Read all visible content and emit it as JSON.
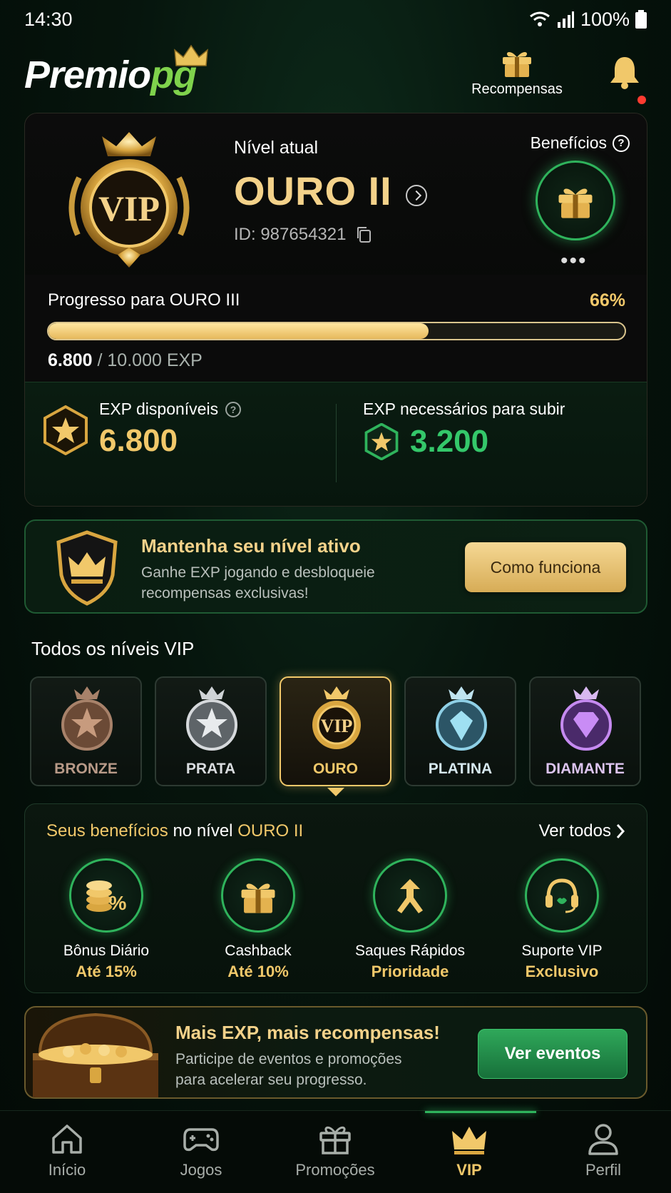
{
  "status_bar": {
    "time": "14:30",
    "battery": "100%"
  },
  "header": {
    "logo_main": "Premio",
    "logo_accent": "pg",
    "rewards_label": "Recompensas"
  },
  "vip_card": {
    "level_label": "Nível atual",
    "level_name": "OURO II",
    "player_id": "ID: 987654321",
    "benefits_label": "Benefícios",
    "badge_text": "VIP",
    "progress_label": "Progresso para OURO III",
    "progress_pct": "66%",
    "progress_value": 0.66,
    "exp_current": "6.800",
    "exp_total": "/ 10.000 EXP",
    "exp_available_label": "EXP disponíveis",
    "exp_available_value": "6.800",
    "exp_needed_label": "EXP necessários para subir",
    "exp_needed_value": "3.200"
  },
  "active_banner": {
    "title": "Mantenha seu nível ativo",
    "text": "Ganhe EXP jogando e desbloqueie recompensas exclusivas!",
    "button": "Como funciona"
  },
  "levels": {
    "title": "Todos os níveis VIP",
    "items": [
      {
        "label": "BRONZE",
        "color": "#a8826a"
      },
      {
        "label": "PRATA",
        "color": "#d6d9dc"
      },
      {
        "label": "OURO",
        "color": "#f1c86a"
      },
      {
        "label": "PLATINA",
        "color": "#cfe6f0"
      },
      {
        "label": "DIAMANTE",
        "color": "#d8b8f0"
      }
    ]
  },
  "benefits": {
    "head_prefix": "Seus benefícios",
    "head_middle": " no nível ",
    "head_level": "OURO II",
    "see_all": "Ver todos",
    "items": [
      {
        "name": "Bônus Diário",
        "value": "Até 15%"
      },
      {
        "name": "Cashback",
        "value": "Até 10%"
      },
      {
        "name": "Saques Rápidos",
        "value": "Prioridade"
      },
      {
        "name": "Suporte VIP",
        "value": "Exclusivo"
      }
    ]
  },
  "promo": {
    "title": "Mais EXP, mais recompensas!",
    "text": "Participe de eventos e promoções para acelerar seu progresso.",
    "button": "Ver eventos"
  },
  "nav": {
    "items": [
      {
        "label": "Início"
      },
      {
        "label": "Jogos"
      },
      {
        "label": "Promoções"
      },
      {
        "label": "VIP"
      },
      {
        "label": "Perfil"
      }
    ]
  }
}
